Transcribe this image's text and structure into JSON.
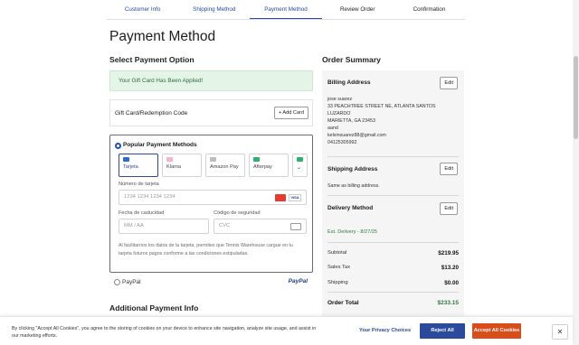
{
  "steps": [
    "Customer Info",
    "Shipping Method",
    "Payment Method",
    "Review Order",
    "Confirmation"
  ],
  "page_title": "Payment Method",
  "select_payment_title": "Select Payment Option",
  "gift_applied": "Your Gift Card Has Been Applied!",
  "gift_row": {
    "label": "Gift Card/Redemption Code",
    "button": "+ Add Card"
  },
  "popular": {
    "title": "Popular Payment Methods",
    "methods": [
      {
        "label": "Tarjeta",
        "icon": "card-icon",
        "color": "#2b6cd4"
      },
      {
        "label": "Klarna",
        "icon": "klarna-icon",
        "color": "#f4b6c7"
      },
      {
        "label": "Amazon Pay",
        "icon": "amazon-icon",
        "color": "#bdbdbd"
      },
      {
        "label": "Afterpay",
        "icon": "afterpay-icon",
        "color": "#2db36f"
      },
      {
        "label": "",
        "icon": "more-icon",
        "color": "#2db36f"
      }
    ],
    "card_number_label": "Número de tarjeta",
    "card_number_placeholder": "1234 1234 1234 1234",
    "expiry_label": "Fecha de caducidad",
    "expiry_placeholder": "MM / AA",
    "cvc_label": "Código de seguridad",
    "cvc_placeholder": "CVC",
    "legal": "Al facilitarnos los datos de la tarjeta, permites que Tennis Warehouse cargue en tu tarjeta futuros pagos conforme a las condiciones estipuladas."
  },
  "paypal": {
    "label": "PayPal",
    "logo": "PayPal"
  },
  "additional_title": "Additional Payment Info",
  "summary": {
    "title": "Order Summary",
    "billing_title": "Billing Address",
    "billing_lines": [
      "jose suarez",
      "33 PEACHTREE STREET NE, ATLANTA SANTOS",
      "LUZARDO",
      "MARIETTA, GA 23453",
      "aand",
      "kelvinsuarez88@gmail.com",
      "04125305992"
    ],
    "shipping_title": "Shipping Address",
    "shipping_text": "Same as billing address.",
    "delivery_title": "Delivery Method",
    "delivery_text": "Est. Delivery - 8/27/25",
    "edit_label": "Edit",
    "subtotal_label": "Subtotal",
    "subtotal": "$219.95",
    "tax_label": "Sales Tax",
    "tax": "$13.20",
    "shipping_label": "Shipping",
    "shipping": "$0.00",
    "total_label": "Order Total",
    "total": "$233.15"
  },
  "cookie": {
    "text": "By clicking \"Accept All Cookies\", you agree to the storing of cookies on your device to enhance site navigation, analyze site usage, and assist in our marketing efforts.",
    "privacy": "Your Privacy Choices",
    "reject": "Reject All",
    "accept": "Accept All Cookies",
    "close": "✕"
  }
}
